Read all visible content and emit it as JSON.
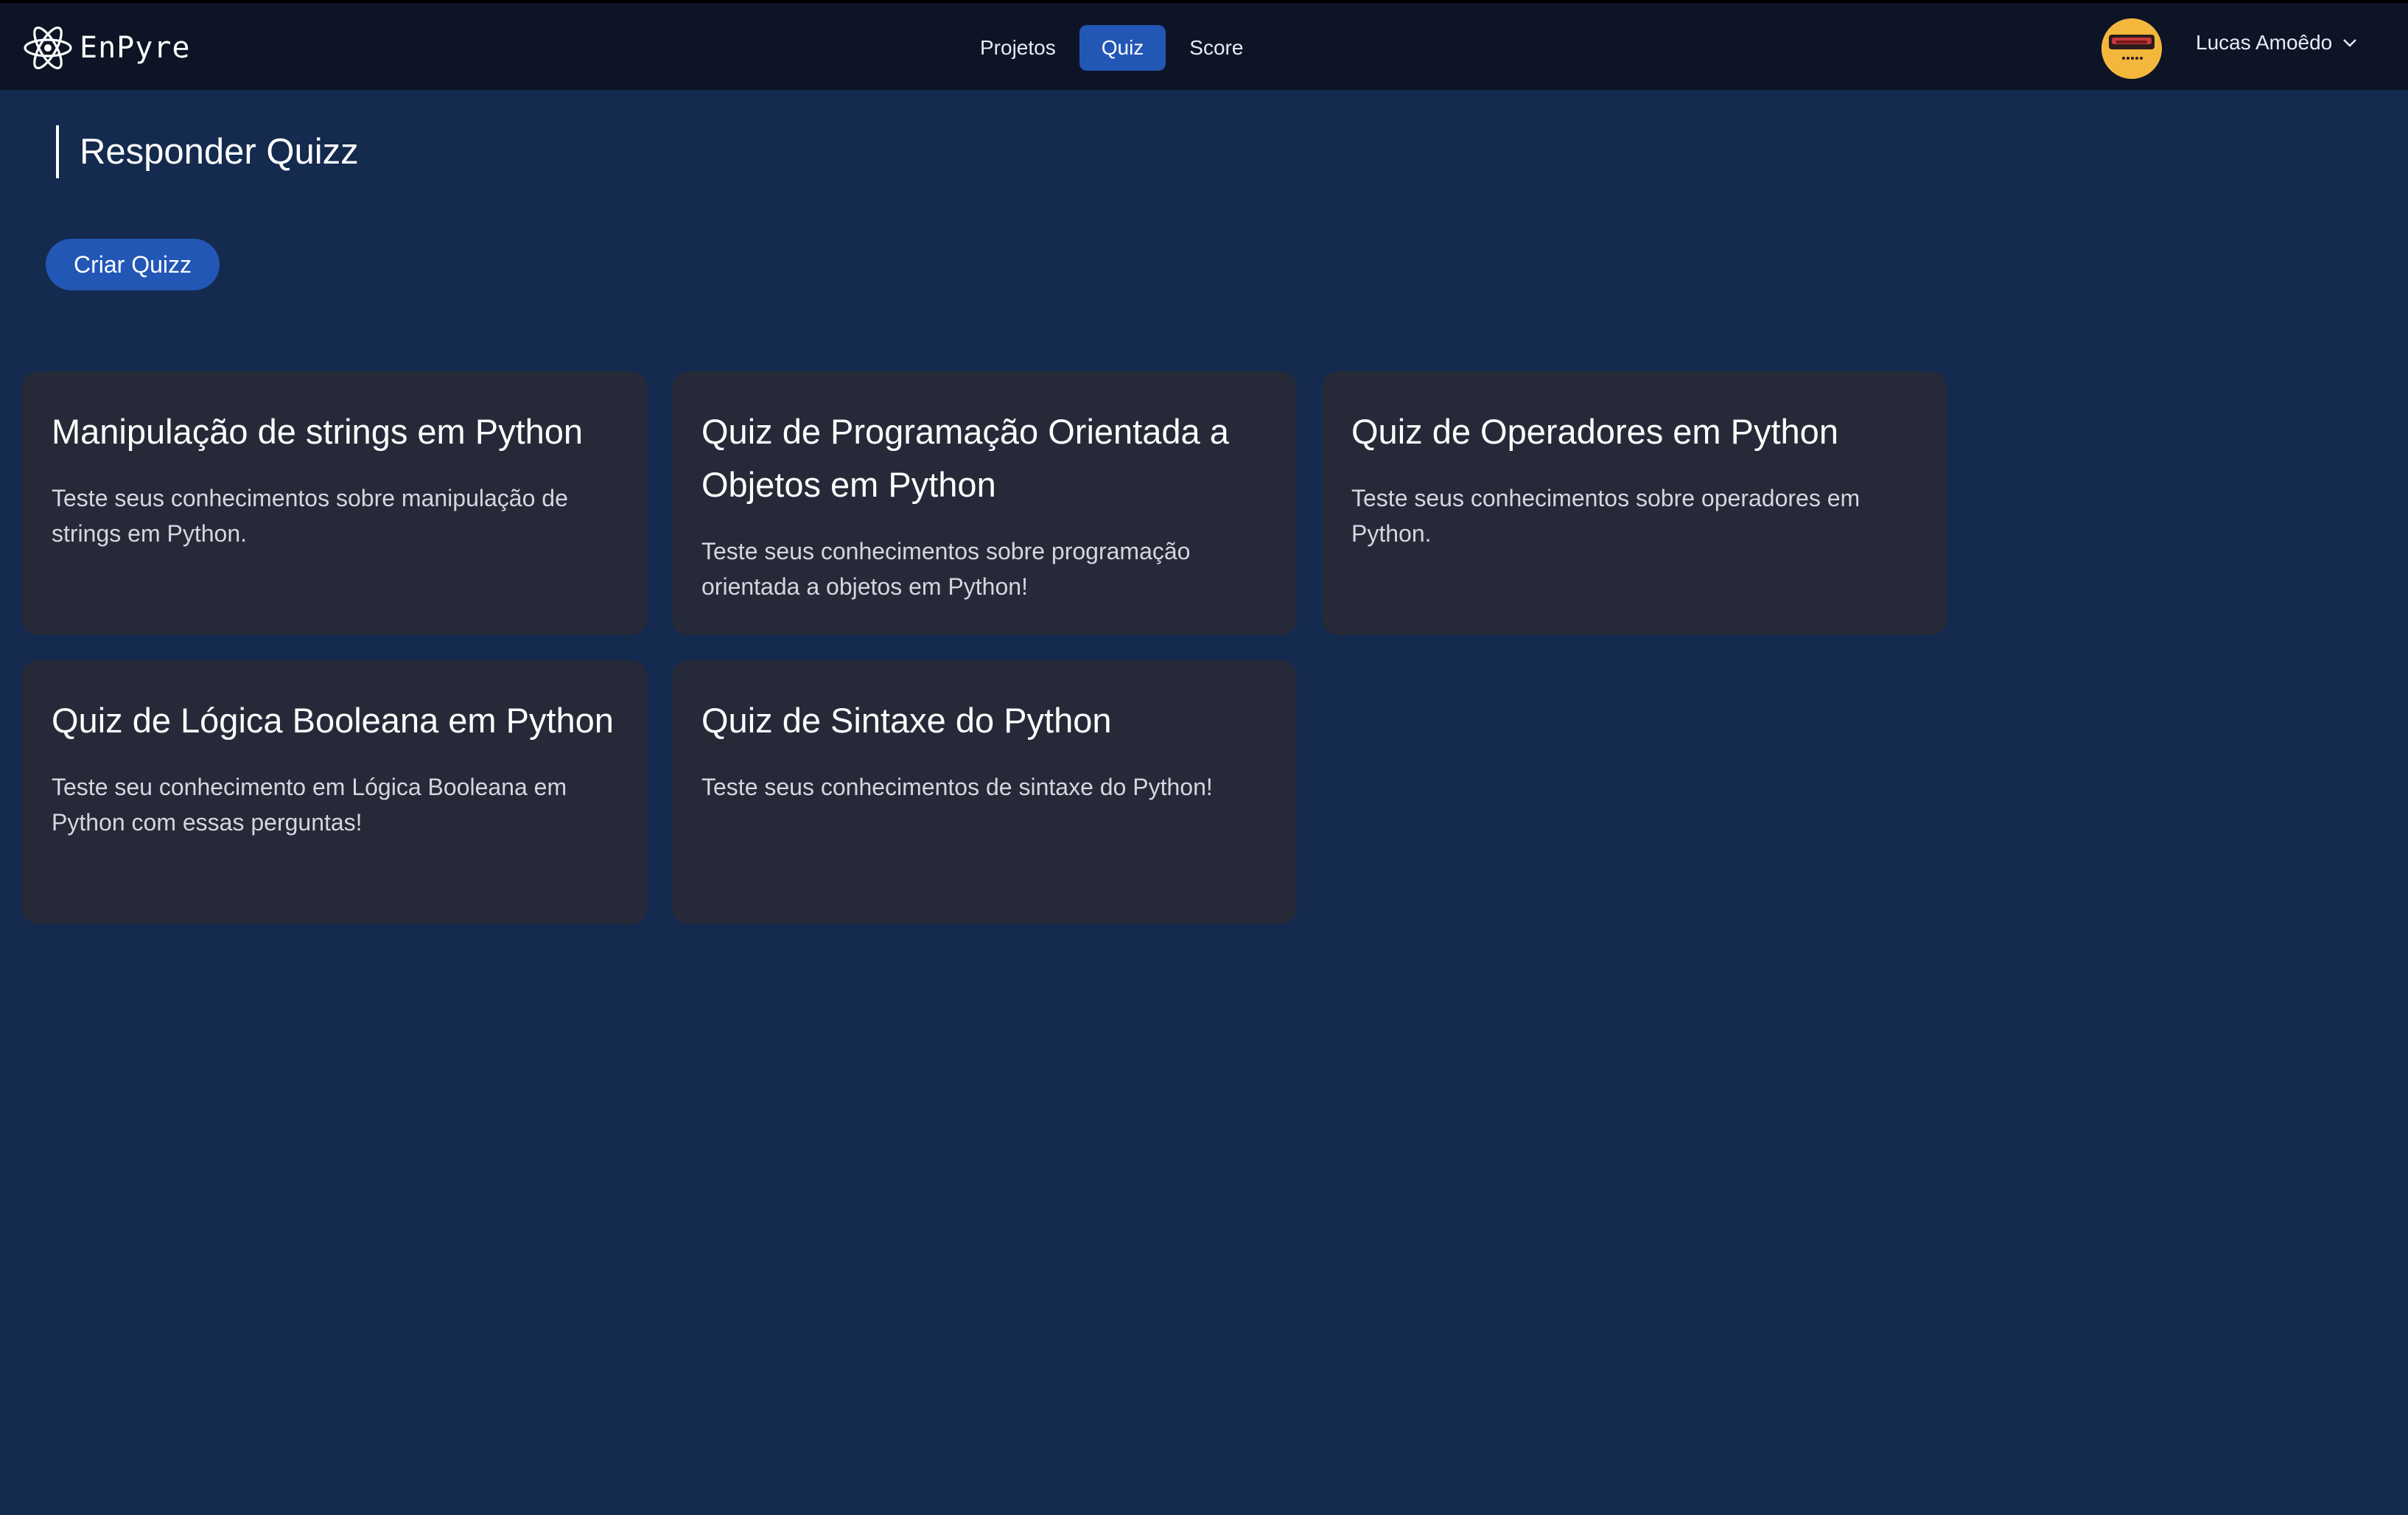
{
  "app": {
    "logo_text": "EnPyre",
    "colors": {
      "background": "#142a4e",
      "topbar": "#0c1425",
      "accent": "#2257b6",
      "card": "#262a38"
    }
  },
  "nav": {
    "items": [
      {
        "label": "Projetos",
        "active": false
      },
      {
        "label": "Quiz",
        "active": true
      },
      {
        "label": "Score",
        "active": false
      }
    ]
  },
  "user": {
    "name": "Lucas Amoêdo",
    "avatar_icon": "avatar-icon"
  },
  "page": {
    "title": "Responder Quizz",
    "create_button": "Criar Quizz"
  },
  "quizzes": [
    {
      "title": "Manipulação de strings em Python",
      "description": "Teste seus conhecimentos sobre manipulação de strings em Python."
    },
    {
      "title": "Quiz de Programação Orientada a Objetos em Python",
      "description": "Teste seus conhecimentos sobre programação orientada a objetos em Python!"
    },
    {
      "title": "Quiz de Operadores em Python",
      "description": "Teste seus conhecimentos sobre operadores em Python."
    },
    {
      "title": "Quiz de Lógica Booleana em Python",
      "description": "Teste seu conhecimento em Lógica Booleana em Python com essas perguntas!"
    },
    {
      "title": "Quiz de Sintaxe do Python",
      "description": "Teste seus conhecimentos de sintaxe do Python!"
    }
  ]
}
